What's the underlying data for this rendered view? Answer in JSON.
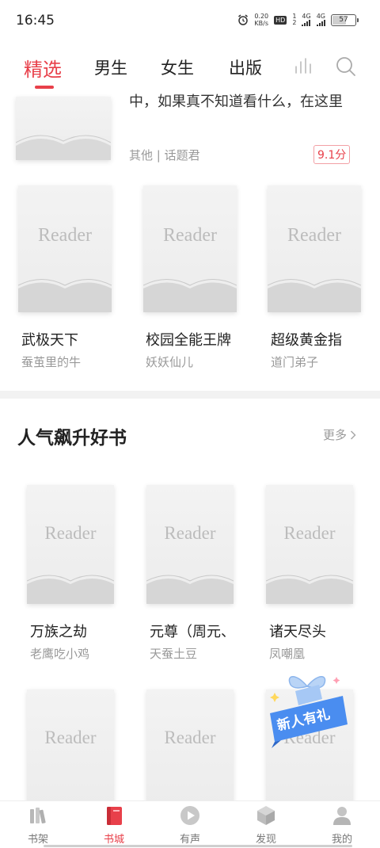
{
  "status_bar": {
    "time": "16:45",
    "net_speed_value": "0.20",
    "net_speed_unit": "KB/s",
    "hd": "HD",
    "sim1": "1",
    "sim2": "2",
    "signal1": "4G",
    "signal2": "4G",
    "battery": "57",
    "battery_level": 0.57
  },
  "top_nav": {
    "tabs": [
      {
        "label": "精选",
        "active": true
      },
      {
        "label": "男生",
        "active": false
      },
      {
        "label": "女生",
        "active": false
      },
      {
        "label": "出版",
        "active": false
      }
    ],
    "rank_icon": "bar-chart-icon",
    "search_icon": "search-icon",
    "accent_color": "#e8404a"
  },
  "partial_book": {
    "description": "中，如果真不知道看什么，在这里",
    "meta": "其他 | 话题君",
    "score": "9.1分"
  },
  "row1": [
    {
      "cover_text": "Reader",
      "title": "武极天下",
      "author": "蚕茧里的牛"
    },
    {
      "cover_text": "Reader",
      "title": "校园全能王牌",
      "author": "妖妖仙儿"
    },
    {
      "cover_text": "Reader",
      "title": "超级黄金指",
      "author": "道门弟子"
    }
  ],
  "section": {
    "title": "人气飙升好书",
    "more": "更多"
  },
  "row2": [
    {
      "cover_text": "Reader",
      "title": "万族之劫",
      "author": "老鹰吃小鸡"
    },
    {
      "cover_text": "Reader",
      "title": "元尊（周元、",
      "author": "天蚕土豆"
    },
    {
      "cover_text": "Reader",
      "title": "诸天尽头",
      "author": "凤嘲凰"
    }
  ],
  "row3": [
    {
      "cover_text": "Reader"
    },
    {
      "cover_text": "Reader"
    },
    {
      "cover_text": "Reader"
    }
  ],
  "gift_popup": {
    "text": "新人有礼",
    "icon": "gift-icon"
  },
  "bottom_nav": [
    {
      "label": "书架",
      "icon": "bookshelf-icon",
      "active": false
    },
    {
      "label": "书城",
      "icon": "bookstore-icon",
      "active": true
    },
    {
      "label": "有声",
      "icon": "play-icon",
      "active": false
    },
    {
      "label": "发现",
      "icon": "cube-icon",
      "active": false
    },
    {
      "label": "我的",
      "icon": "user-icon",
      "active": false
    }
  ]
}
